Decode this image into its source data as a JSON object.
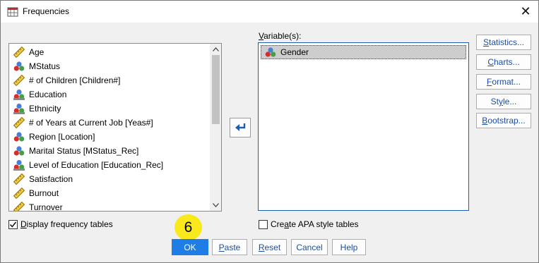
{
  "window": {
    "title": "Frequencies",
    "close_glyph": "✕"
  },
  "source_list": {
    "items": [
      {
        "label": "Age",
        "icon": "scale-ruler-icon"
      },
      {
        "label": "MStatus",
        "icon": "nominal-balls-icon"
      },
      {
        "label": "# of Children [Children#]",
        "icon": "scale-ruler-icon"
      },
      {
        "label": "Education",
        "icon": "ordinal-bars-icon"
      },
      {
        "label": "Ethnicity",
        "icon": "ordinal-bars-icon"
      },
      {
        "label": "# of Years at Current Job [Yeas#]",
        "icon": "scale-ruler-icon"
      },
      {
        "label": "Region [Location]",
        "icon": "nominal-balls-icon"
      },
      {
        "label": "Marital Status [MStatus_Rec]",
        "icon": "nominal-balls-icon"
      },
      {
        "label": "Level of Education [Education_Rec]",
        "icon": "ordinal-bars-icon"
      },
      {
        "label": "Satisfaction",
        "icon": "scale-ruler-icon"
      },
      {
        "label": "Burnout",
        "icon": "scale-ruler-icon"
      },
      {
        "label": "Turnover",
        "icon": "scale-ruler-icon"
      }
    ]
  },
  "variables": {
    "label_mnemonic": "V",
    "label_rest": "ariable(s):",
    "items": [
      {
        "label": "Gender",
        "icon": "nominal-balls-icon"
      }
    ]
  },
  "side_buttons": {
    "statistics": {
      "m": "S",
      "rest": "tatistics..."
    },
    "charts": {
      "m": "C",
      "rest": "harts..."
    },
    "format": {
      "m": "F",
      "rest": "ormat..."
    },
    "style": {
      "pre": "St",
      "m": "y",
      "rest": "le..."
    },
    "bootstrap": {
      "m": "B",
      "rest": "ootstrap..."
    }
  },
  "checkboxes": {
    "display_freq": {
      "m": "D",
      "rest": "isplay frequency tables",
      "checked": true
    },
    "apa": {
      "pre": "Cre",
      "m": "a",
      "rest": "te APA style tables",
      "checked": false
    }
  },
  "bottom_buttons": {
    "ok": "OK",
    "paste": {
      "m": "P",
      "rest": "aste"
    },
    "reset": {
      "m": "R",
      "rest": "eset"
    },
    "cancel": "Cancel",
    "help": "Help"
  },
  "step_badge": "6",
  "colors": {
    "accent": "#1e7ee6",
    "badge": "#f8e81c",
    "link_text": "#1a4ea6"
  }
}
